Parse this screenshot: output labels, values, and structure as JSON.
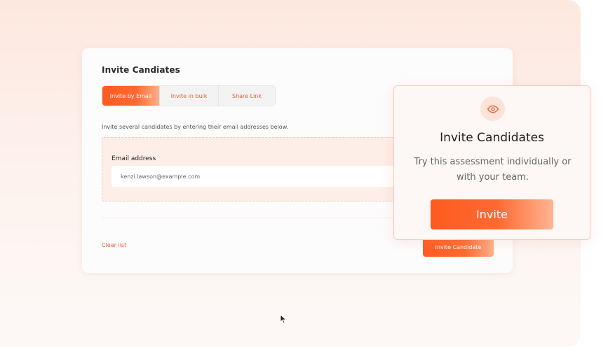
{
  "main_card": {
    "title": "Invite Candiates",
    "tabs": [
      {
        "label": "Invite by Email",
        "active": true
      },
      {
        "label": "Invite in bulk",
        "active": false
      },
      {
        "label": "Share Link",
        "active": false
      }
    ],
    "helper_text": "Invite several candidates by entering their email addresses below.",
    "email": {
      "label": "Email address",
      "value": "kenzi.lawson@example.com"
    },
    "clear_list_label": "Clear list",
    "invite_candidate_label": "Invite Candidate"
  },
  "overlay": {
    "icon": "eye-icon",
    "title": "Invite Candidates",
    "description": "Try this assessment individually or with your team.",
    "button_label": "Invite"
  },
  "colors": {
    "accent": "#ff5a1f",
    "accent_light": "#ffb08c",
    "background_tint": "#fde8df"
  }
}
